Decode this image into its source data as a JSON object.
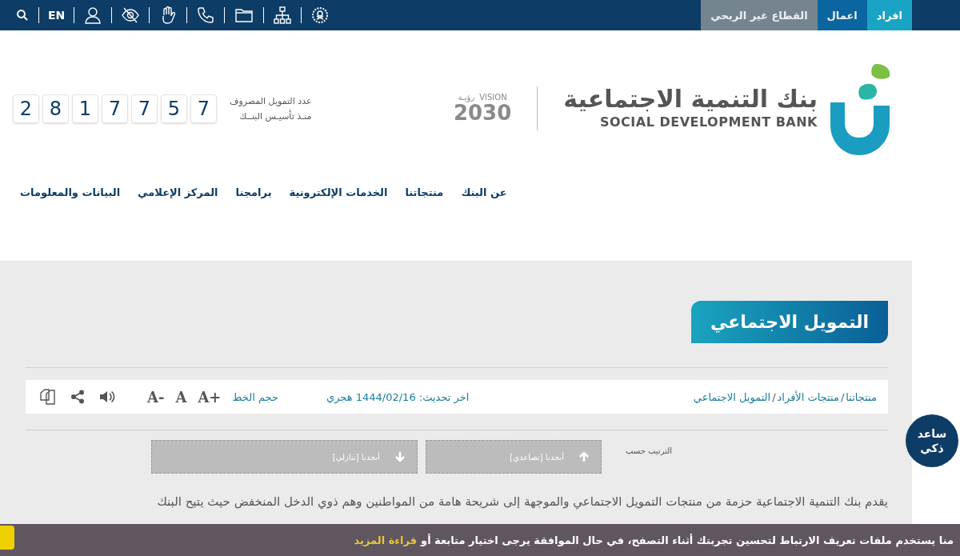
{
  "top_bar": {
    "tabs": [
      {
        "label": "افراد",
        "selected": true,
        "color": "#1aa3c4"
      },
      {
        "label": "اعمال",
        "selected": false,
        "color": "#0b69a6"
      },
      {
        "label": "القطاع غير الربحي",
        "selected": false,
        "color": "#7e8c94"
      }
    ],
    "language": "EN"
  },
  "header": {
    "logo": {
      "name_ar": "بنك التنمية الاجتماعية",
      "name_en": "SOCIAL DEVELOPMENT BANK"
    },
    "vision": {
      "label_ar": "رؤيـة",
      "label_en": "VISION",
      "year": "2030"
    },
    "counter": {
      "label_line_1": "عدد التمويل المصروف",
      "label_line_2": "منـذ تأسيـس البنــك",
      "digits": [
        "7",
        "5",
        "7",
        "7",
        "1",
        "8",
        "2"
      ]
    }
  },
  "nav": {
    "items": [
      "عن البنك",
      "منتجاتنا",
      "الخدمات الإلكترونية",
      "برامجنا",
      "المركز الإعلامي",
      "البيانات والمعلومات"
    ]
  },
  "page": {
    "title": "التمويل الاجتماعي",
    "breadcrumb": [
      "منتجاتنا",
      "منتجات الأفراد",
      "التمويل الاجتماعي"
    ],
    "breadcrumb_separator": "/",
    "last_update": "اخر تحديث: 1444/02/16 هجري",
    "font_size": {
      "label": "حجم الخط",
      "buttons": [
        "A+",
        "A",
        "A-"
      ]
    },
    "sort": {
      "label": "الترتيب حسب",
      "buttons": [
        {
          "label": "أبجديا [تصاعدي]",
          "kind": "up"
        },
        {
          "label": "أبجديا [تنازلي]",
          "kind": "down"
        }
      ]
    },
    "paragraph": "يقدم بنك التنمية الاجتماعية حزمة من منتجات التمويل الاجتماعي والموجهة إلى شريحة هامة من المواطنين وهم ذوي الدخل المنخفض حيث يتيح البنك"
  },
  "assistant": {
    "line_1": "ساعد",
    "line_2": "ذكي"
  },
  "cookie_bar": {
    "text": "منا يستخدم ملفات تعريف الارتباط لتحسين تجربتك أثناء التصفح، في حال الموافقة يرجى اختيار متابعة أو",
    "link": "قراءة المزيد"
  }
}
